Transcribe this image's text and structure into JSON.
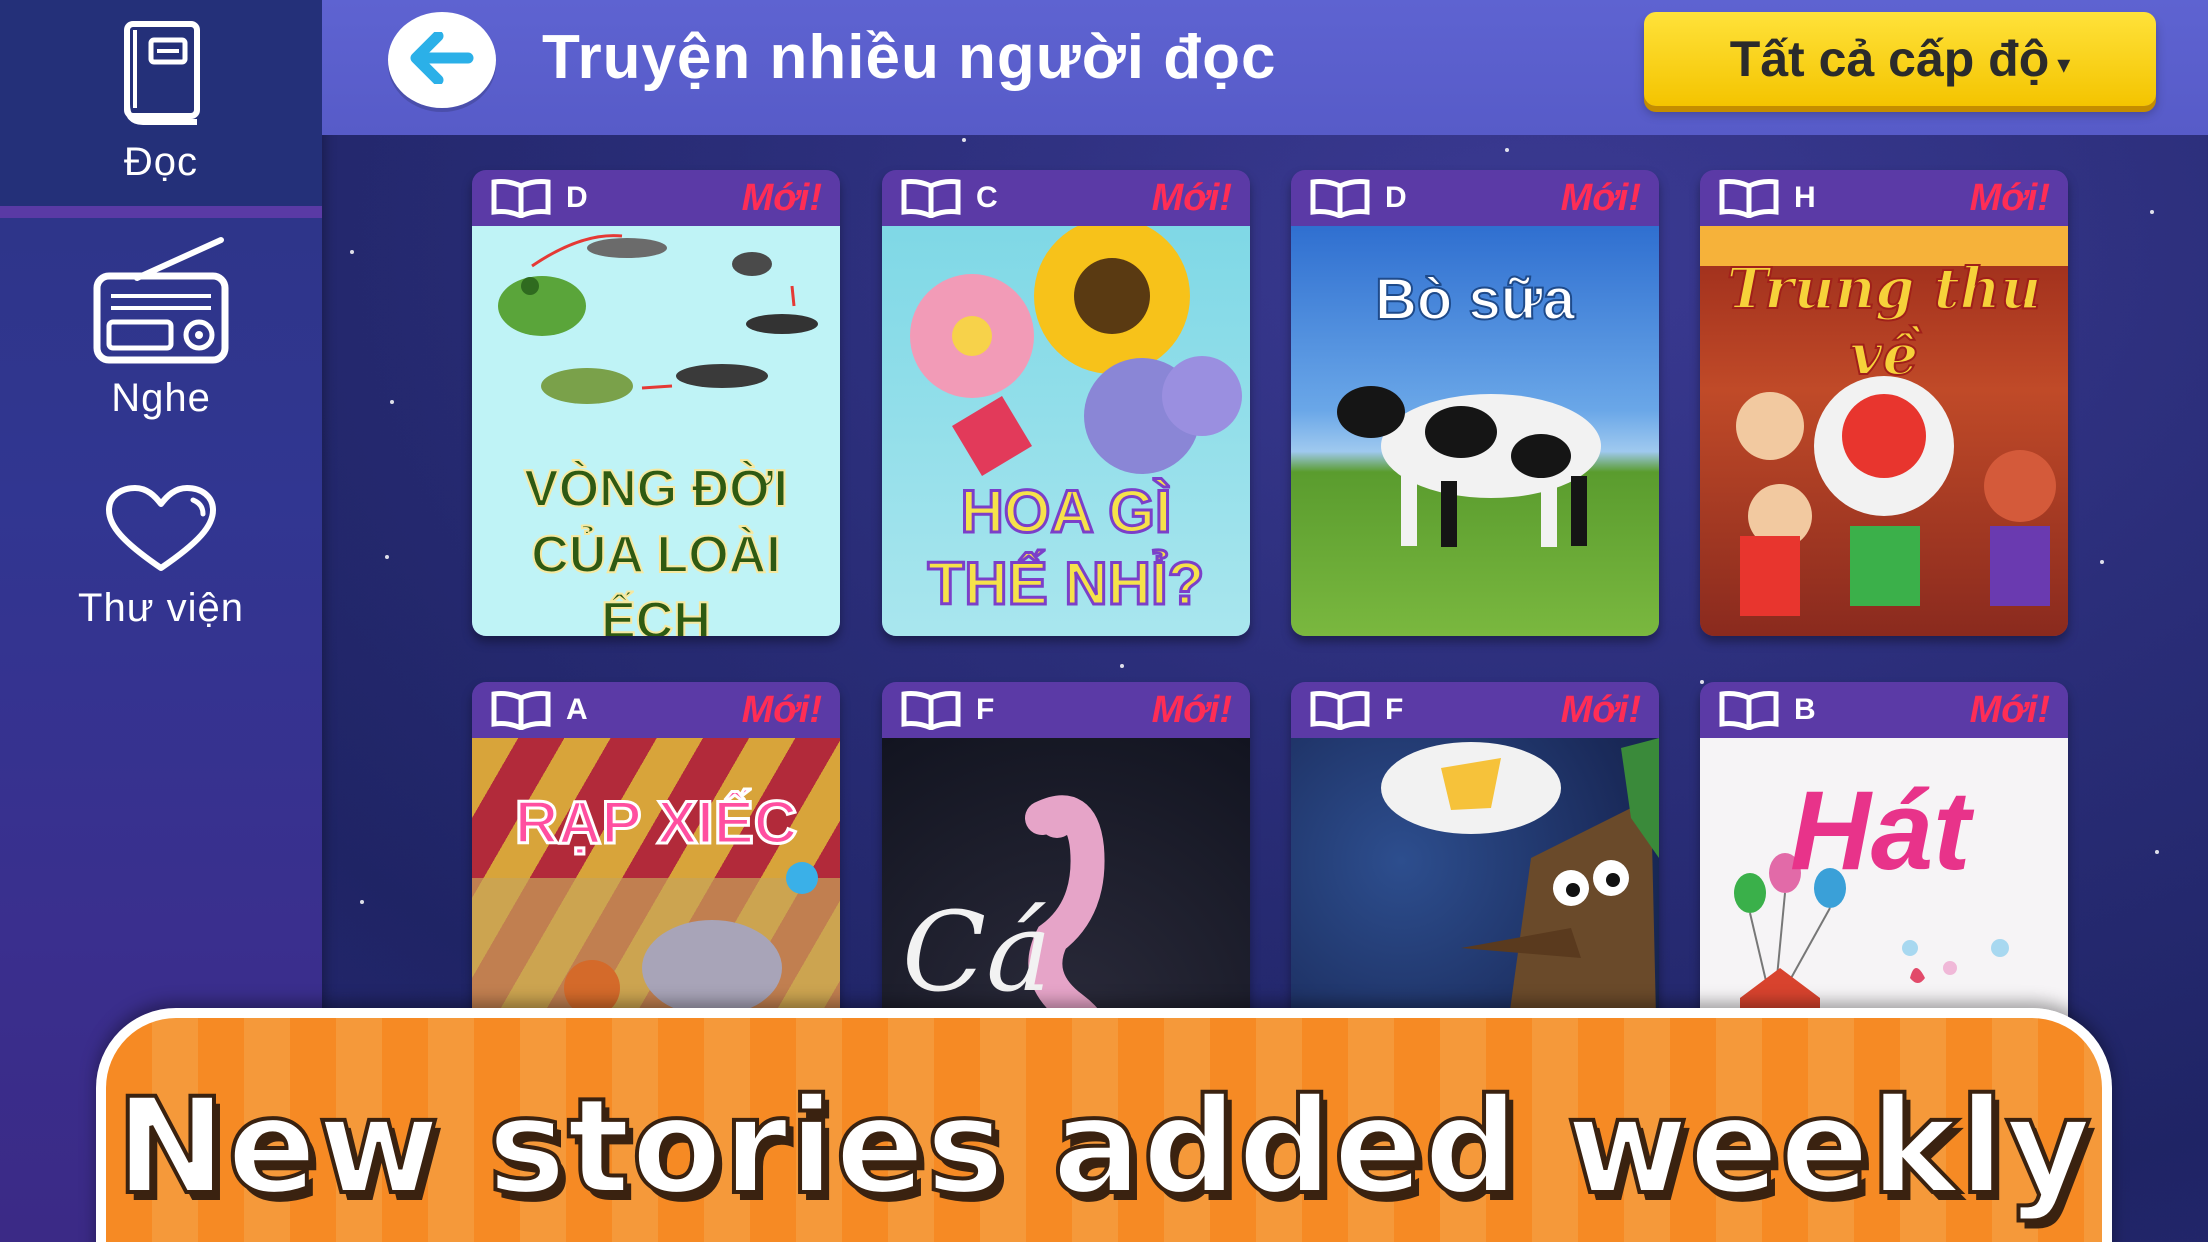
{
  "sidebar": {
    "items": [
      {
        "label": "Đọc",
        "icon": "book-icon",
        "active": true
      },
      {
        "label": "Nghe",
        "icon": "radio-icon",
        "active": false
      },
      {
        "label": "Thư viện",
        "icon": "heart-icon",
        "active": false
      }
    ]
  },
  "header": {
    "back_icon": "arrow-left-icon",
    "title": "Truyện nhiều người đọc",
    "level_filter": {
      "selected": "Tất cả cấp độ",
      "caret": "▾"
    }
  },
  "books": [
    {
      "level": "D",
      "badge": "Mới!",
      "cover_text": "VÒNG ĐỜI CỦA LOÀI ẾCH"
    },
    {
      "level": "C",
      "badge": "Mới!",
      "cover_text": "HOA GÌ THẾ NHỈ?"
    },
    {
      "level": "D",
      "badge": "Mới!",
      "cover_text": "Bò sữa"
    },
    {
      "level": "H",
      "badge": "Mới!",
      "cover_text": "Trung thu về"
    },
    {
      "level": "A",
      "badge": "Mới!",
      "cover_text": "RẠP XIẾC"
    },
    {
      "level": "F",
      "badge": "Mới!",
      "cover_text": "Cá"
    },
    {
      "level": "F",
      "badge": "Mới!",
      "cover_text": ""
    },
    {
      "level": "B",
      "badge": "Mới!",
      "cover_text": "Hát"
    }
  ],
  "banner": {
    "text": "New stories added weekly"
  },
  "colors": {
    "badge_new": "#ff2d55",
    "card_header": "#5b3aa6",
    "level_button": "#f4c400",
    "banner": "#f68a24",
    "back_arrow": "#2bb0e8"
  }
}
